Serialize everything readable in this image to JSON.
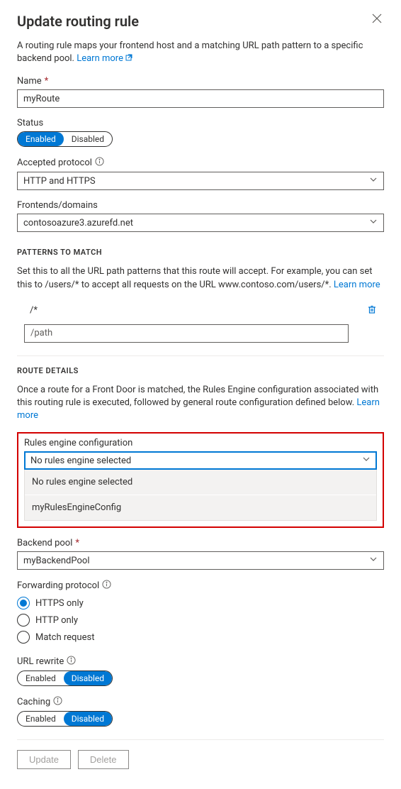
{
  "header": {
    "title": "Update routing rule"
  },
  "intro": {
    "text": "A routing rule maps your frontend host and a matching URL path pattern to a specific backend pool. ",
    "learn_more": "Learn more"
  },
  "name": {
    "label": "Name",
    "value": "myRoute"
  },
  "status": {
    "label": "Status",
    "opt_enabled": "Enabled",
    "opt_disabled": "Disabled"
  },
  "accepted_protocol": {
    "label": "Accepted protocol",
    "value": "HTTP and HTTPS"
  },
  "frontends": {
    "label": "Frontends/domains",
    "value": "contosoazure3.azurefd.net"
  },
  "patterns": {
    "heading": "PATTERNS TO MATCH",
    "desc": "Set this to all the URL path patterns that this route will accept. For example, you can set this to /users/* to accept all requests on the URL www.contoso.com/users/*. ",
    "learn_more": "Learn more",
    "existing": "/*",
    "placeholder": "/path"
  },
  "route": {
    "heading": "ROUTE DETAILS",
    "desc": "Once a route for a Front Door is matched, the Rules Engine configuration associated with this routing rule is executed, followed by general route configuration defined below. ",
    "learn_more": "Learn more"
  },
  "rules_engine": {
    "label": "Rules engine configuration",
    "value": "No rules engine selected",
    "options": [
      "No rules engine selected",
      "myRulesEngineConfig"
    ]
  },
  "backend_pool": {
    "label": "Backend pool",
    "value": "myBackendPool"
  },
  "forwarding_protocol": {
    "label": "Forwarding protocol",
    "opts": [
      "HTTPS only",
      "HTTP only",
      "Match request"
    ],
    "selected": 0
  },
  "url_rewrite": {
    "label": "URL rewrite",
    "opt_enabled": "Enabled",
    "opt_disabled": "Disabled"
  },
  "caching": {
    "label": "Caching",
    "opt_enabled": "Enabled",
    "opt_disabled": "Disabled"
  },
  "footer": {
    "update": "Update",
    "delete": "Delete"
  }
}
